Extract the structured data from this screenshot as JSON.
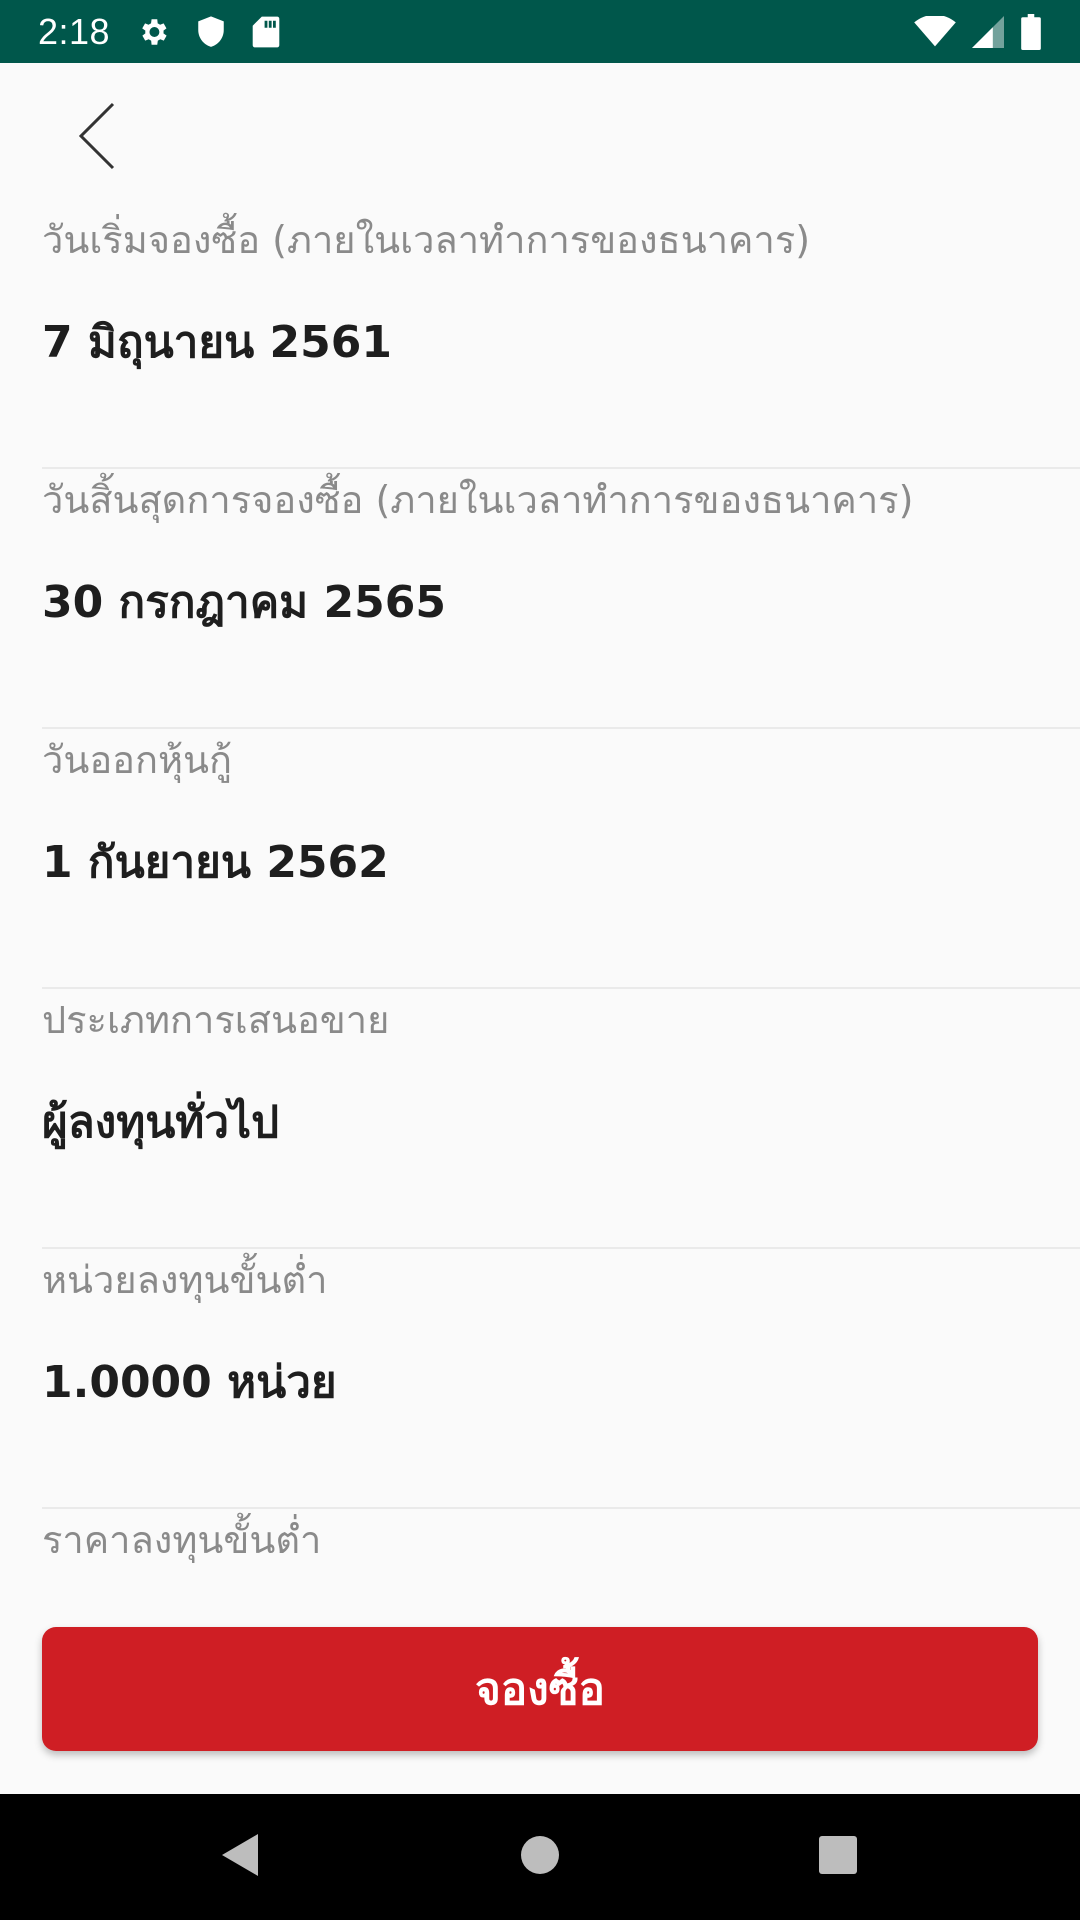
{
  "status_bar": {
    "time": "2:18",
    "left_icons": [
      "gear-icon",
      "shield-icon",
      "sd-card-icon"
    ],
    "right_icons": [
      "wifi-icon",
      "cellular-signal-icon",
      "battery-icon"
    ],
    "background_color": "#00574b"
  },
  "header": {
    "back_icon": "chevron-left-icon"
  },
  "fields": [
    {
      "label": "วันเริ่มจองซื้อ (ภายในเวลาทำการของธนาคาร)",
      "value": "7 มิถุนายน 2561"
    },
    {
      "label": "วันสิ้นสุดการจองซื้อ (ภายในเวลาทำการของธนาคาร)",
      "value": "30 กรกฎาคม 2565"
    },
    {
      "label": "วันออกหุ้นกู้",
      "value": "1 กันยายน 2562"
    },
    {
      "label": "ประเภทการเสนอขาย",
      "value": "ผู้ลงทุนทั่วไป"
    },
    {
      "label": "หน่วยลงทุนขั้นต่ำ",
      "value": "1.0000 หน่วย"
    },
    {
      "label": "ราคาลงทุนขั้นต่ำ",
      "value": ""
    }
  ],
  "cta": {
    "label": "จองซื้อ",
    "color": "#cf1e24"
  },
  "nav_bar": {
    "icons": [
      "back-triangle-icon",
      "home-circle-icon",
      "recents-square-icon"
    ]
  }
}
